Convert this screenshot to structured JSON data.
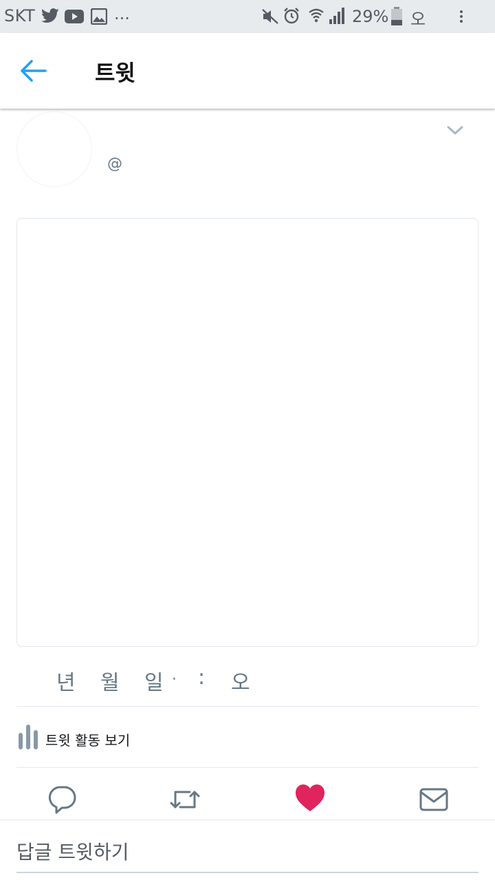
{
  "status_bar": {
    "carrier": "SKT",
    "dots": "...",
    "battery_percent": "29%",
    "korean_indicator": "오",
    "icons": [
      "twitter-icon",
      "youtube-icon",
      "gallery-icon",
      "mute-icon",
      "alarm-icon",
      "wifi-icon",
      "signal-icon",
      "battery-icon",
      "overflow-menu-icon"
    ]
  },
  "app_bar": {
    "back_icon": "arrow-left-icon",
    "title": "트윗"
  },
  "tweet": {
    "handle": "@",
    "timestamp": {
      "year": "년",
      "month": "월",
      "day": "일",
      "dot": "·",
      "colon": ":",
      "ampm": "오"
    }
  },
  "activity": {
    "label": "트윗 활동 보기"
  },
  "actions": {
    "reply_icon": "reply-icon",
    "retweet_icon": "retweet-icon",
    "like_icon": "heart-icon",
    "dm_icon": "mail-icon"
  },
  "reply": {
    "placeholder": "답글 트윗하기"
  },
  "colors": {
    "accent": "#1da1f2",
    "like": "#e0245e",
    "icon_gray": "#657786",
    "divider": "#e1e8ed"
  }
}
